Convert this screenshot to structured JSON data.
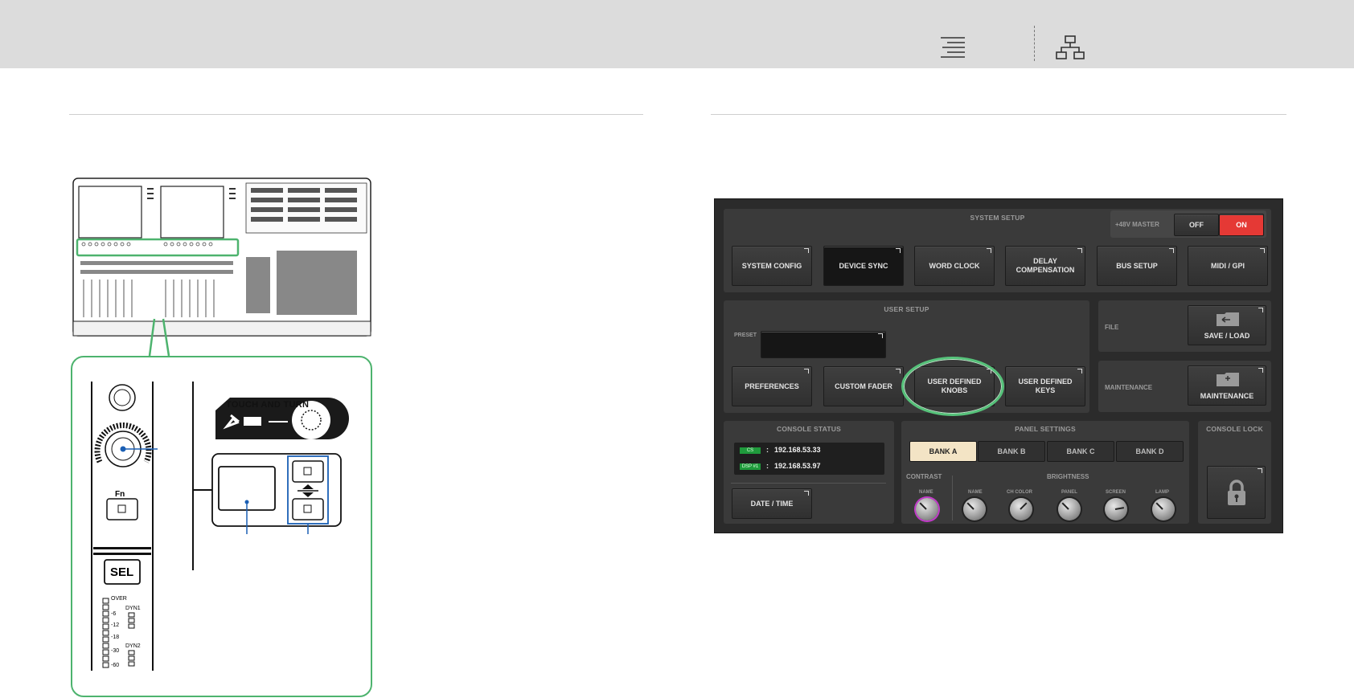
{
  "header": {
    "menu_icon": "menu-lines-icon",
    "sitemap_icon": "sitemap-icon"
  },
  "illustration": {
    "touch_and_turn_label": "TOUCH AND TURN",
    "fn_label": "Fn",
    "sel_label": "SEL",
    "meter_labels": [
      "OVER",
      "-6",
      "-12",
      "-18",
      "-30",
      "-60"
    ],
    "dyn1_label": "DYN1",
    "dyn2_label": "DYN2",
    "highlight_color": "#4db36e",
    "callout_color": "#1a5fb4"
  },
  "screen": {
    "system_setup": {
      "title": "SYSTEM SETUP",
      "phantom_label": "+48V MASTER",
      "phantom_off": "OFF",
      "phantom_on": "ON",
      "buttons": [
        "SYSTEM CONFIG",
        "DEVICE SYNC",
        "WORD CLOCK",
        "DELAY COMPENSATION",
        "BUS SETUP",
        "MIDI / GPI"
      ]
    },
    "user_setup": {
      "title": "USER SETUP",
      "preset_label": "PRESET",
      "buttons": [
        "PREFERENCES",
        "CUSTOM FADER",
        "USER DEFINED KNOBS",
        "USER DEFINED KEYS"
      ]
    },
    "file": {
      "label": "FILE",
      "button": "SAVE / LOAD"
    },
    "maintenance": {
      "label": "MAINTENANCE",
      "button": "MAINTENANCE"
    },
    "console_status": {
      "title": "CONSOLE STATUS",
      "rows": [
        {
          "badge": "CS",
          "sep": ":",
          "ip": "192.168.53.33"
        },
        {
          "badge": "DSP #1",
          "sep": ":",
          "ip": "192.168.53.97"
        }
      ],
      "date_time_button": "DATE / TIME"
    },
    "panel_settings": {
      "title": "PANEL SETTINGS",
      "banks": [
        "BANK A",
        "BANK B",
        "BANK C",
        "BANK D"
      ],
      "selected_bank": "BANK A",
      "contrast_label": "CONTRAST",
      "brightness_label": "BRIGHTNESS",
      "contrast_knobs": [
        "NAME"
      ],
      "brightness_knobs": [
        "NAME",
        "CH COLOR",
        "PANEL",
        "SCREEN",
        "LAMP"
      ]
    },
    "console_lock": {
      "title": "CONSOLE LOCK"
    },
    "colors": {
      "on_red": "#e53935",
      "bank_selected": "#f3e4c5",
      "badge_green": "#1f9a3c",
      "contrast_ring": "#c23ac9",
      "highlight_ring": "#56c27a"
    }
  }
}
